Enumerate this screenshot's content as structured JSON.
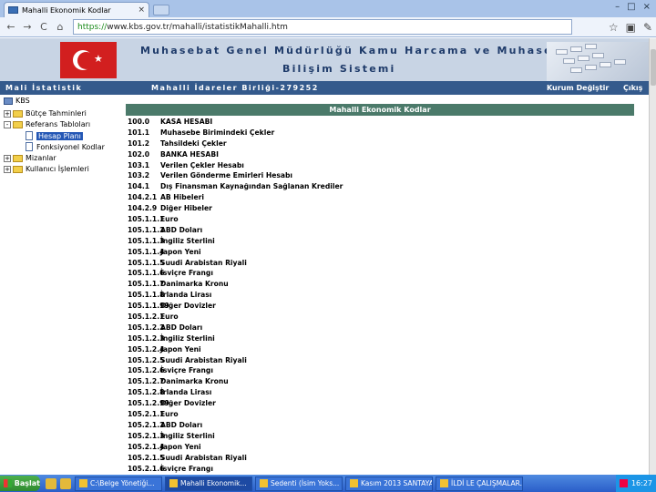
{
  "browser": {
    "tab_title": "Mahalli Ekonomik Kodlar",
    "tab_close": "×",
    "window_buttons": [
      "–",
      "□",
      "×"
    ],
    "nav": {
      "back": "←",
      "forward": "→",
      "reload": "C",
      "home": "⌂"
    },
    "url_scheme": "https://",
    "url_rest": "www.kbs.gov.tr/mahalli/istatistikMahalli.htm",
    "right_icons": [
      "☆",
      "▣",
      "✎"
    ]
  },
  "header": {
    "title_line1": "Muhasebat Genel Müdürlüğü Kamu Harcama ve Muhasebe",
    "title_line2": "Bilişim Sistemi",
    "bar_left": "Mali İstatistik",
    "bar_mid": "Mahalli İdareler Birliği-279252",
    "bar_right1": "Kurum Değiştir",
    "bar_right2": "Çıkış"
  },
  "tree": {
    "root": "KBS",
    "items": [
      {
        "label": "Bütçe Tahminleri",
        "box": "+"
      },
      {
        "label": "Referans Tabloları",
        "box": "-"
      },
      {
        "label": "Hesap Planı"
      },
      {
        "label": "Fonksiyonel Kodlar"
      },
      {
        "label": "Mizanlar",
        "box": "+"
      },
      {
        "label": "Kullanıcı İşlemleri",
        "box": "+"
      }
    ]
  },
  "content": {
    "heading": "Mahalli Ekonomik Kodlar",
    "rows": [
      {
        "code": "100.0",
        "name": "KASA HESABI"
      },
      {
        "code": "101.1",
        "name": "Muhasebe Birimindeki Çekler"
      },
      {
        "code": "101.2",
        "name": "Tahsildeki Çekler"
      },
      {
        "code": "102.0",
        "name": "BANKA HESABI"
      },
      {
        "code": "103.1",
        "name": "Verilen Çekler Hesabı"
      },
      {
        "code": "103.2",
        "name": "Verilen Gönderme Emirleri Hesabı"
      },
      {
        "code": "104.1",
        "name": "Dış Finansman Kaynağından Sağlanan Krediler"
      },
      {
        "code": "104.2.1",
        "name": "AB Hibeleri"
      },
      {
        "code": "104.2.9",
        "name": "Diğer Hibeler"
      },
      {
        "code": "105.1.1.1",
        "name": "Euro"
      },
      {
        "code": "105.1.1.2",
        "name": "ABD Doları"
      },
      {
        "code": "105.1.1.3",
        "name": "İngiliz Sterlini"
      },
      {
        "code": "105.1.1.4",
        "name": "Japon Yeni"
      },
      {
        "code": "105.1.1.5",
        "name": "Suudi Arabistan Riyali"
      },
      {
        "code": "105.1.1.6",
        "name": "İsviçre Frangı"
      },
      {
        "code": "105.1.1.7",
        "name": "Danimarka Kronu"
      },
      {
        "code": "105.1.1.8",
        "name": "İrlanda Lirası"
      },
      {
        "code": "105.1.1.99",
        "name": "Diğer Dovizler"
      },
      {
        "code": "105.1.2.1",
        "name": "Euro"
      },
      {
        "code": "105.1.2.2",
        "name": "ABD Doları"
      },
      {
        "code": "105.1.2.3",
        "name": "İngiliz Sterlini"
      },
      {
        "code": "105.1.2.4",
        "name": "Japon Yeni"
      },
      {
        "code": "105.1.2.5",
        "name": "Suudi Arabistan Riyali"
      },
      {
        "code": "105.1.2.6",
        "name": "İsviçre Frangı"
      },
      {
        "code": "105.1.2.7",
        "name": "Danimarka Kronu"
      },
      {
        "code": "105.1.2.8",
        "name": "İrlanda Lirası"
      },
      {
        "code": "105.1.2.99",
        "name": "Diğer Dovizler"
      },
      {
        "code": "105.2.1.1",
        "name": "Euro"
      },
      {
        "code": "105.2.1.2",
        "name": "ABD Doları"
      },
      {
        "code": "105.2.1.3",
        "name": "İngiliz Sterlini"
      },
      {
        "code": "105.2.1.4",
        "name": "Japon Yeni"
      },
      {
        "code": "105.2.1.5",
        "name": "Suudi Arabistan Riyali"
      },
      {
        "code": "105.2.1.6",
        "name": "İsviçre Frangı"
      }
    ]
  },
  "taskbar": {
    "start": "Başlat",
    "items": [
      {
        "label": "C:\\Belge Yönetiği..."
      },
      {
        "label": "Mahalli Ekonomik..."
      },
      {
        "label": "Sedenti (İsim Yoks..."
      },
      {
        "label": "Kasım 2013 SANTAYA..."
      },
      {
        "label": "İLDİ LE ÇALIŞMALAR..."
      }
    ],
    "clock": "16:27"
  }
}
